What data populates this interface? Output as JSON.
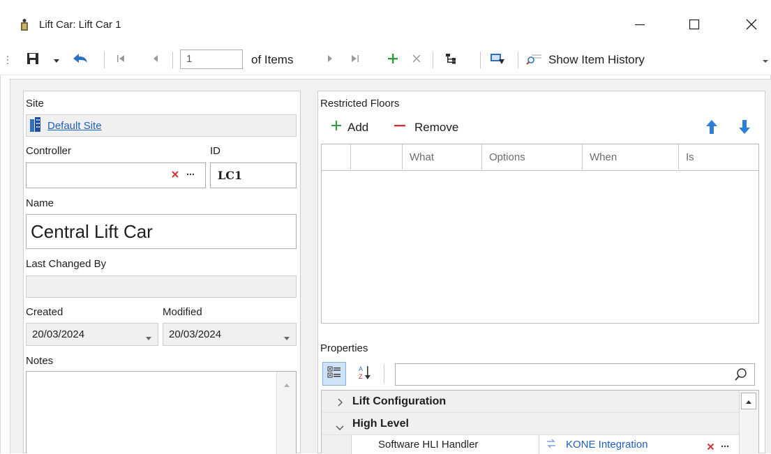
{
  "window": {
    "title": "Lift Car: Lift Car 1",
    "icon": "lift-car-icon",
    "controls": [
      "minimize-icon",
      "maximize-icon",
      "close-icon"
    ]
  },
  "toolbar": {
    "page_value": "1",
    "of_items_label": "of Items",
    "show_history_label": "Show Item History"
  },
  "form": {
    "site_label": "Site",
    "site_value": "Default Site",
    "controller_label": "Controller",
    "controller_value": "",
    "id_label": "ID",
    "id_value": "LC1",
    "name_label": "Name",
    "name_value": "Central Lift Car",
    "last_changed_label": "Last Changed By",
    "last_changed_value": "",
    "created_label": "Created",
    "created_value": "20/03/2024",
    "modified_label": "Modified",
    "modified_value": "20/03/2024",
    "notes_label": "Notes",
    "notes_value": ""
  },
  "restricted_floors": {
    "title": "Restricted Floors",
    "add_label": "Add",
    "remove_label": "Remove",
    "columns": [
      "",
      "",
      "What",
      "Options",
      "When",
      "Is"
    ]
  },
  "properties": {
    "title": "Properties",
    "search_value": "",
    "sort_az_label": "A Z",
    "groups": [
      {
        "name": "Lift Configuration",
        "expanded": false
      },
      {
        "name": "High Level",
        "expanded": true
      }
    ],
    "rows": [
      {
        "name": "Software HLI Handler",
        "value": "KONE Integration"
      }
    ]
  },
  "colors": {
    "accent_green": "#2e9d3a",
    "accent_red": "#d13438",
    "link_blue": "#1f5fbf",
    "arrow_blue": "#2f7fd8"
  }
}
